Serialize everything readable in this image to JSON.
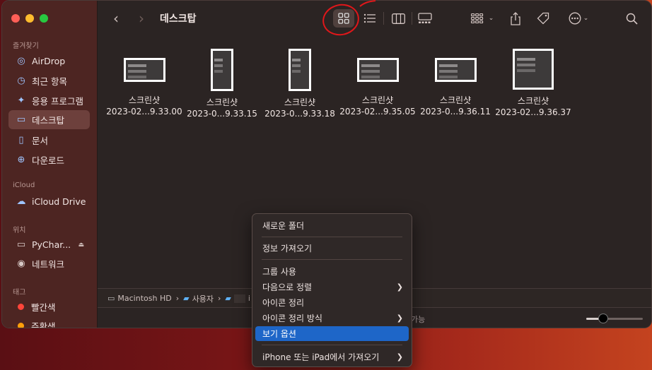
{
  "window": {
    "title": "데스크탑"
  },
  "sidebar": {
    "sections": [
      {
        "label": "즐겨찾기"
      },
      {
        "label": "iCloud"
      },
      {
        "label": "위치"
      },
      {
        "label": "태그"
      }
    ],
    "items": [
      {
        "label": "AirDrop",
        "icon": "airdrop-icon"
      },
      {
        "label": "최근 항목",
        "icon": "clock-icon"
      },
      {
        "label": "응용 프로그램",
        "icon": "applications-icon"
      },
      {
        "label": "데스크탑",
        "icon": "desktop-icon",
        "selected": true
      },
      {
        "label": "문서",
        "icon": "document-icon"
      },
      {
        "label": "다운로드",
        "icon": "download-icon"
      },
      {
        "label": "iCloud Drive",
        "icon": "cloud-icon"
      },
      {
        "label": "PyChar...",
        "icon": "drive-icon"
      },
      {
        "label": "네트워크",
        "icon": "network-icon"
      },
      {
        "label": "빨간색",
        "color": "#ff453a"
      },
      {
        "label": "주황색",
        "color": "#ff9f0a"
      }
    ]
  },
  "files": [
    {
      "name": "스크린샷",
      "date": "2023-02...9.33.00"
    },
    {
      "name": "스크린샷",
      "date": "2023-0...9.33.15"
    },
    {
      "name": "스크린샷",
      "date": "2023-0...9.33.18"
    },
    {
      "name": "스크린샷",
      "date": "2023-02...9.35.05"
    },
    {
      "name": "스크린샷",
      "date": "2023-0...9.36.11"
    },
    {
      "name": "스크린샷",
      "date": "2023-02...9.36.37"
    }
  ],
  "pathbar": [
    "Macintosh HD",
    "사용자",
    "i"
  ],
  "status": {
    "text": "가능"
  },
  "icon_size_slider": {
    "value": 0.3
  },
  "context_menu": {
    "items": [
      {
        "label": "새로운 폴더"
      },
      {
        "label": "정보 가져오기"
      },
      {
        "label": "그룹 사용"
      },
      {
        "label": "다음으로 정렬",
        "submenu": true
      },
      {
        "label": "아이콘 정리"
      },
      {
        "label": "아이콘 정리 방식",
        "submenu": true
      },
      {
        "label": "보기 옵션",
        "highlighted": true
      },
      {
        "label": "iPhone 또는 iPad에서 가져오기",
        "submenu": true
      }
    ]
  }
}
